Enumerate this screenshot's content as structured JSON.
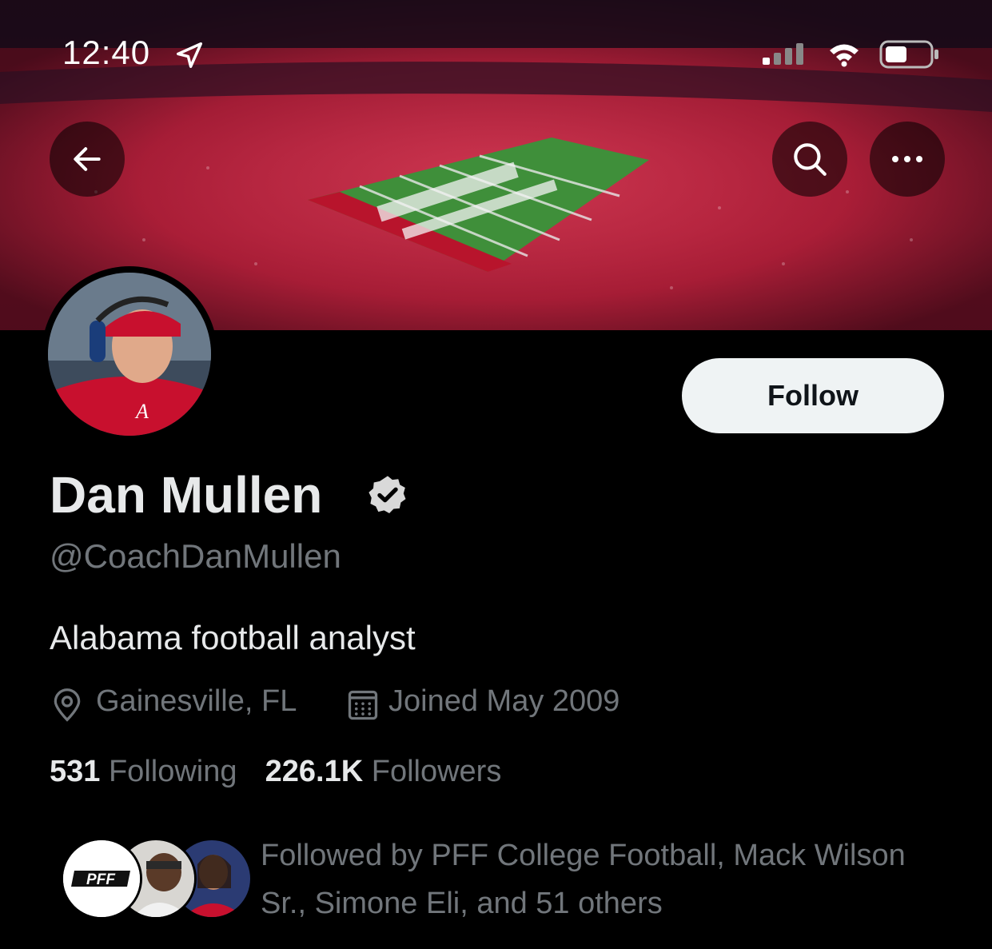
{
  "status_bar": {
    "time": "12:40",
    "icons": [
      "location-arrow-icon",
      "signal-icon",
      "wifi-icon",
      "battery-icon"
    ]
  },
  "nav": {
    "icons": [
      "back-arrow-icon",
      "search-icon",
      "more-icon"
    ]
  },
  "profile": {
    "display_name": "Dan Mullen",
    "verified": true,
    "handle": "@CoachDanMullen",
    "bio": "Alabama football analyst",
    "location": "Gainesville, FL",
    "joined": "Joined May 2009",
    "following_count": "531",
    "following_label": "Following",
    "followers_count": "226.1K",
    "followers_label": "Followers",
    "follow_button_label": "Follow",
    "followed_by_text": "Followed by PFF College Football, Mack Wilson Sr., Simone Eli, and 51 others",
    "pff_logo_text": "PFF"
  },
  "colors": {
    "background": "#000000",
    "primary_text": "#e7e9ea",
    "secondary_text": "#71767b",
    "follow_button_bg": "#eff3f4",
    "crimson": "#c8102e"
  }
}
